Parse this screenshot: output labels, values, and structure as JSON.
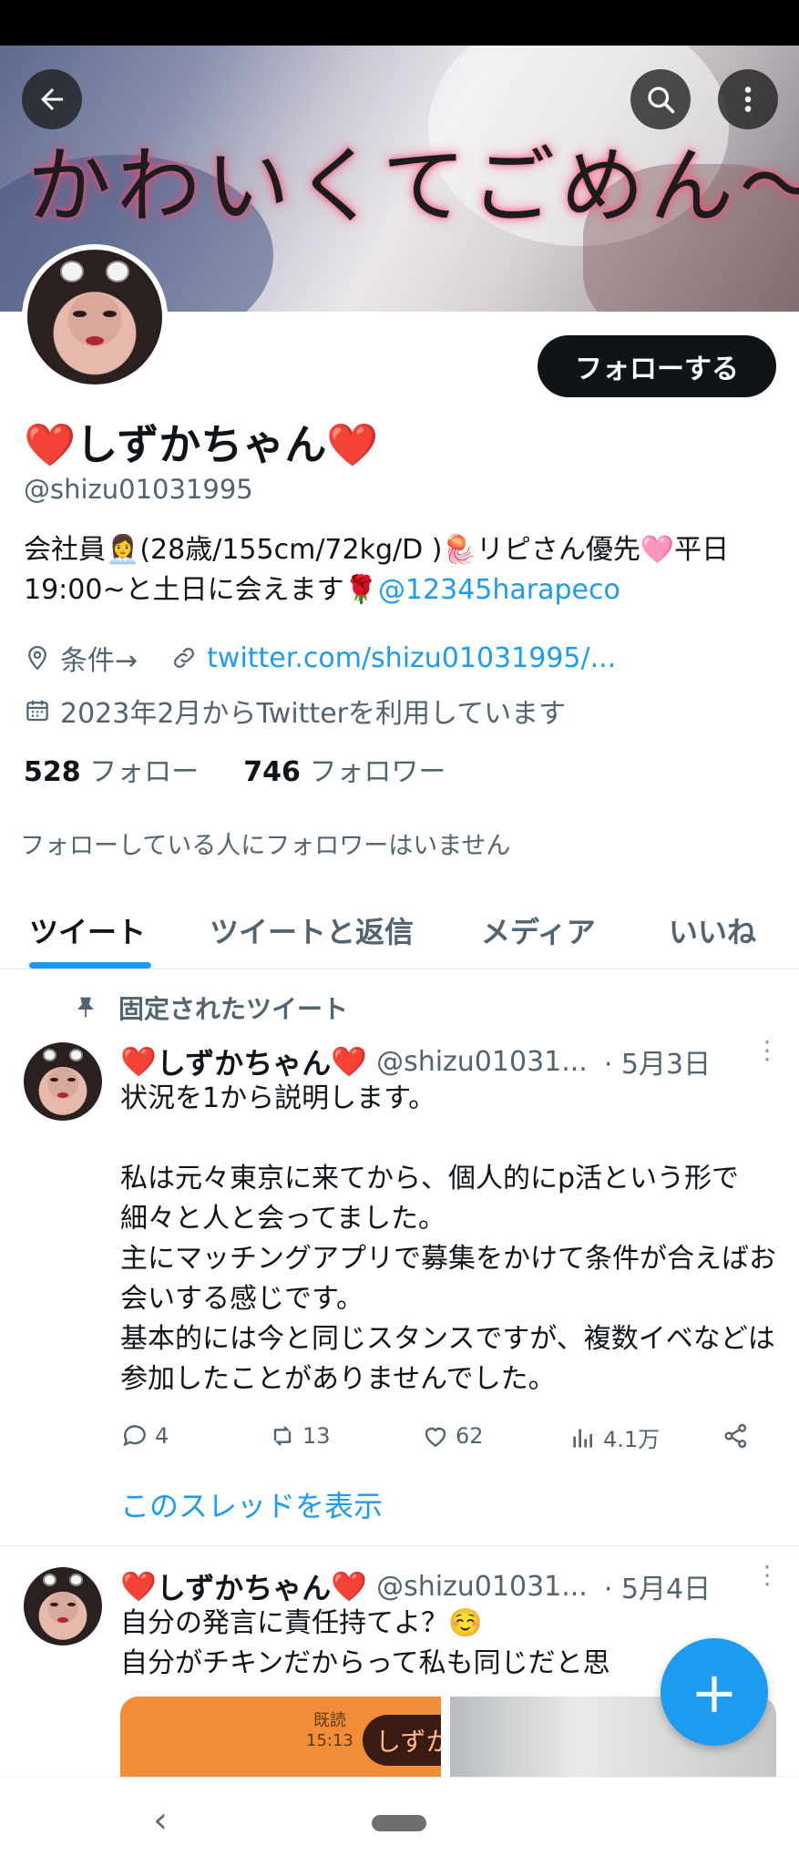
{
  "banner": {
    "text": "かわいくてごめん〜"
  },
  "header_buttons": {
    "back_icon": "arrow-left-icon",
    "search_icon": "search-icon",
    "more_icon": "more-vertical-icon"
  },
  "profile": {
    "follow_label": "フォローする",
    "name": "しずかちゃん",
    "name_emoji": "❤️",
    "handle": "@shizu01031995",
    "bio_text": "会社員👩‍💼(28歳/155cm/72kg/D )🪼リピさん優先🩷平日19:00~と土日に会えます🌹",
    "bio_mention": "@12345harapeco",
    "location": "条件→",
    "link": "twitter.com/shizu01031995/...",
    "joined": "2023年2月からTwitterを利用しています",
    "following_count": "528",
    "following_label": "フォロー",
    "followers_count": "746",
    "followers_label": "フォロワー",
    "no_mutuals": "フォローしている人にフォロワーはいません"
  },
  "tabs": [
    {
      "label": "ツイート",
      "active": true
    },
    {
      "label": "ツイートと返信",
      "active": false
    },
    {
      "label": "メディア",
      "active": false
    },
    {
      "label": "いいね",
      "active": false
    }
  ],
  "pinned_label": "固定されたツイート",
  "tweets": [
    {
      "name": "しずかちゃん",
      "handle": "@shizu01031...",
      "date": "· 5月3日",
      "text": "状況を1から説明します。\n\n私は元々東京に来てから、個人的にp活という形で細々と人と会ってました。\n主にマッチングアプリで募集をかけて条件が合えばお会いする感じです。\n基本的には今と同じスタンスですが、複数イベなどは参加したことがありませんでした。",
      "replies": "4",
      "retweets": "13",
      "likes": "62",
      "views": "4.1万",
      "show_thread": "このスレッドを表示"
    },
    {
      "name": "しずかちゃん",
      "handle": "@shizu01031...",
      "date": "· 5月4日",
      "text": "自分の発言に責任持てよ？☺️\n自分がチキンだからって私も同じだと思",
      "media_read": "既読",
      "media_time": "15:13",
      "media_bubble": "しずか"
    }
  ],
  "fab_label": "+",
  "nav": {
    "back": "‹"
  },
  "colors": {
    "accent": "#1d9bf0",
    "text": "#0f1419",
    "muted": "#536471",
    "heart": "#e0245e"
  }
}
